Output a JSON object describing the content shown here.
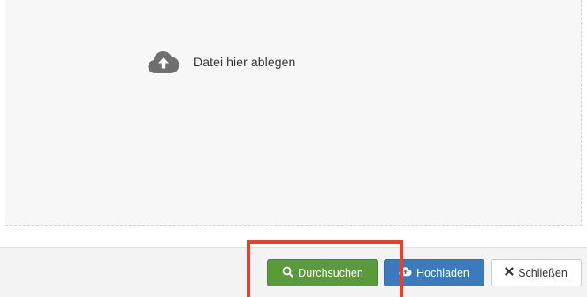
{
  "dropzone": {
    "label": "Datei hier ablegen",
    "icon": "cloud-upload-icon"
  },
  "buttons": {
    "browse": {
      "label": "Durchsuchen",
      "icon": "search-icon",
      "color": "#5b9a3c"
    },
    "upload": {
      "label": "Hochladen",
      "icon": "cloud-upload-icon",
      "color": "#3b7bbd"
    },
    "close": {
      "label": "Schließen",
      "icon": "close-icon",
      "color": "#ffffff"
    }
  },
  "highlight": {
    "color": "#e8412a",
    "target": "browse-button"
  }
}
